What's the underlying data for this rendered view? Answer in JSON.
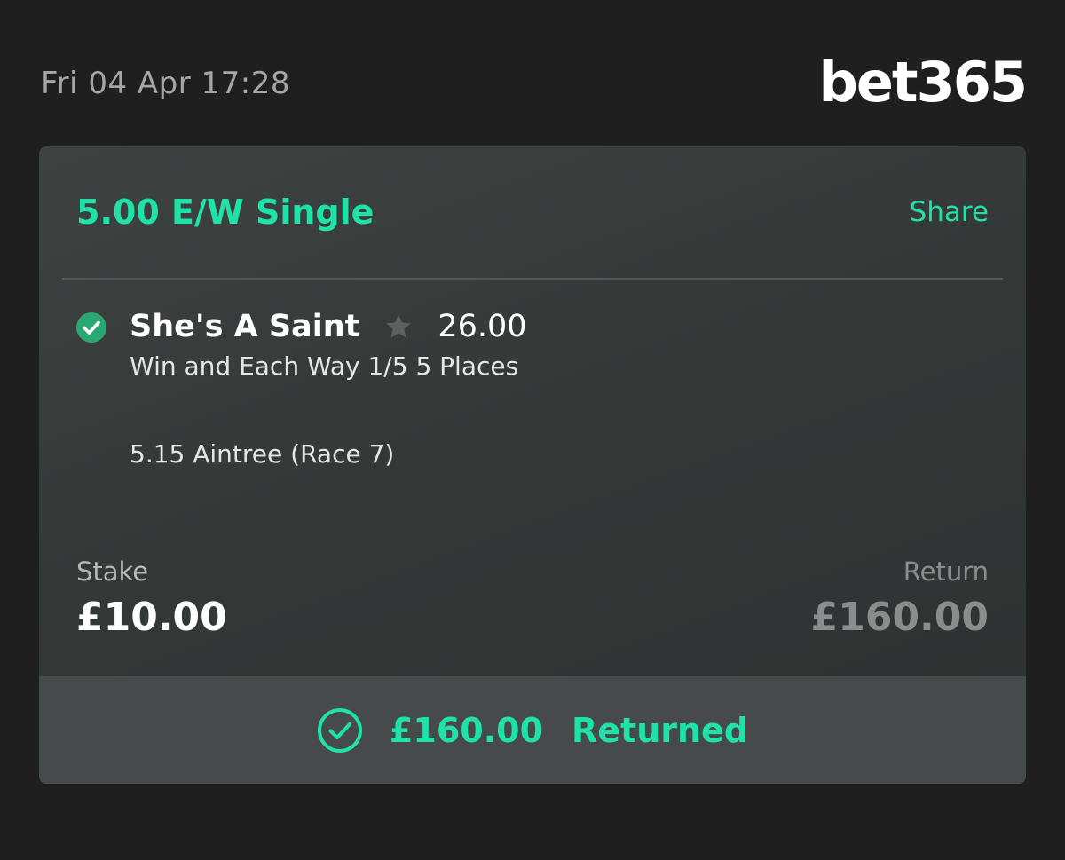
{
  "header": {
    "datetime": "Fri 04 Apr 17:28",
    "logo_text": "bet365"
  },
  "bet": {
    "type": "5.00 E/W Single",
    "share_label": "Share",
    "selection": {
      "name": "She's A Saint",
      "odds": "26.00",
      "market": "Win and Each Way 1/5 5 Places",
      "event": "5.15 Aintree (Race 7)",
      "status_icon": "check-circle-icon",
      "favourite_icon": "star-icon"
    },
    "stake_label": "Stake",
    "stake_value": "£10.00",
    "return_label": "Return",
    "return_value": "£160.00"
  },
  "footer": {
    "icon": "check-circle-outline-icon",
    "amount": "£160.00",
    "status": "Returned"
  },
  "colors": {
    "accent": "#1fe2a8",
    "background": "#1f1f1f",
    "card": "#373b3a",
    "footer": "#474a4a",
    "win_check": "#2aa874"
  }
}
